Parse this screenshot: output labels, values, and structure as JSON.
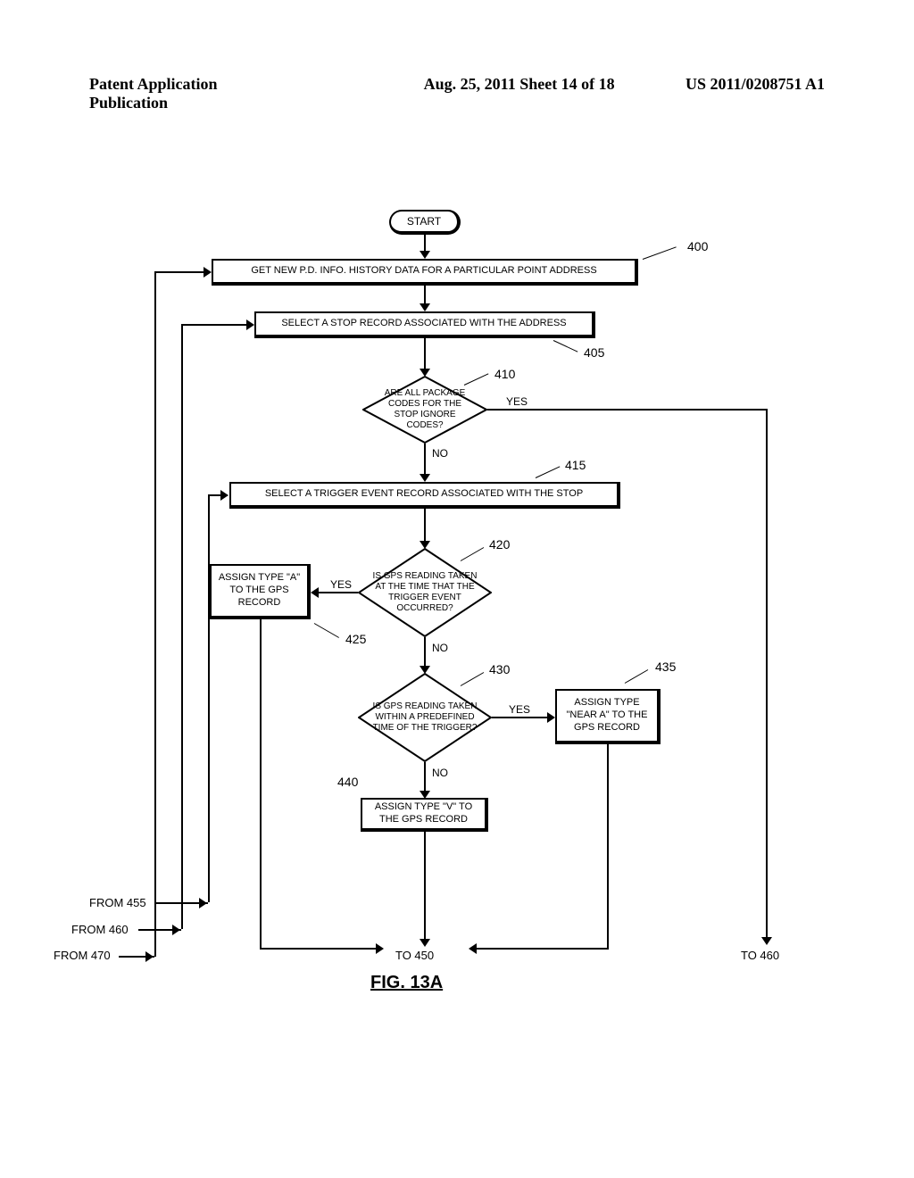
{
  "header": {
    "left": "Patent Application Publication",
    "center": "Aug. 25, 2011  Sheet 14 of 18",
    "right": "US 2011/0208751 A1"
  },
  "flowchart": {
    "start_label": "START",
    "step400": "GET NEW P.D. INFO. HISTORY DATA FOR A PARTICULAR POINT ADDRESS",
    "step405": "SELECT A STOP RECORD ASSOCIATED WITH THE ADDRESS",
    "dec410": "ARE ALL PACKAGE CODES FOR THE STOP IGNORE CODES?",
    "step415": "SELECT A TRIGGER EVENT RECORD ASSOCIATED WITH THE STOP",
    "dec420": "IS GPS READING TAKEN AT THE TIME THAT THE TRIGGER EVENT OCCURRED?",
    "step425": "ASSIGN TYPE \"A\" TO THE GPS RECORD",
    "dec430": "IS GPS READING TAKEN WITHIN A PREDEFINED TIME OF THE TRIGGER?",
    "step435": "ASSIGN TYPE \"NEAR A\" TO THE GPS RECORD",
    "step440": "ASSIGN TYPE \"V\" TO THE GPS RECORD",
    "yes": "YES",
    "no": "NO",
    "ref400": "400",
    "ref405": "405",
    "ref410": "410",
    "ref415": "415",
    "ref420": "420",
    "ref425": "425",
    "ref430": "430",
    "ref435": "435",
    "ref440": "440",
    "connectors": {
      "from455": "FROM 455",
      "from460": "FROM 460",
      "from470": "FROM 470",
      "to450": "TO 450",
      "to460": "TO 460"
    },
    "figure_label": "FIG. 13A"
  }
}
